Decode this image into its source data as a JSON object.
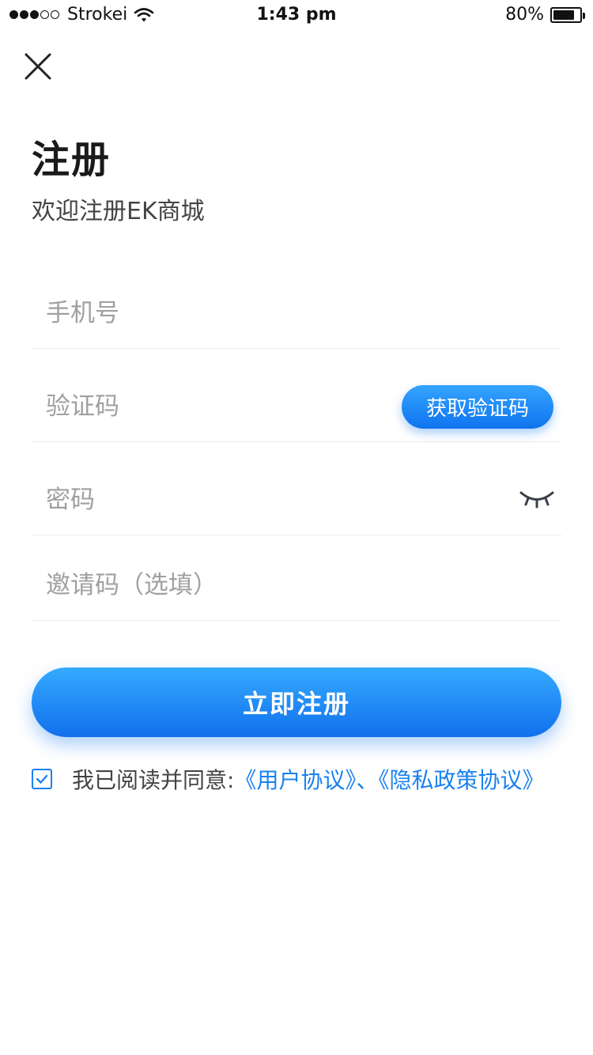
{
  "status_bar": {
    "carrier": "Strokei",
    "time": "1:43 pm",
    "battery": "80%",
    "battery_level": 0.8,
    "signal_bars": 5,
    "signal_filled": 3
  },
  "header": {
    "title": "注册",
    "subtitle": "欢迎注册EK商城"
  },
  "form": {
    "phone_placeholder": "手机号",
    "code_placeholder": "验证码",
    "get_code_label": "获取验证码",
    "password_placeholder": "密码",
    "invite_placeholder": "邀请码（选填）"
  },
  "register_label": "立即注册",
  "agreement": {
    "prefix": "我已阅读并同意:",
    "link_user": "《用户协议》",
    "separator": "、",
    "link_privacy": "《隐私政策协议》",
    "checked": true
  },
  "colors": {
    "accent": "#1a82ef",
    "gradient_top": "#35aaff",
    "gradient_bottom": "#1170ec"
  },
  "icons": {
    "close": "close-icon",
    "eye": "eye-closed-icon",
    "check": "check-icon",
    "wifi": "wifi-icon",
    "battery": "battery-icon"
  }
}
